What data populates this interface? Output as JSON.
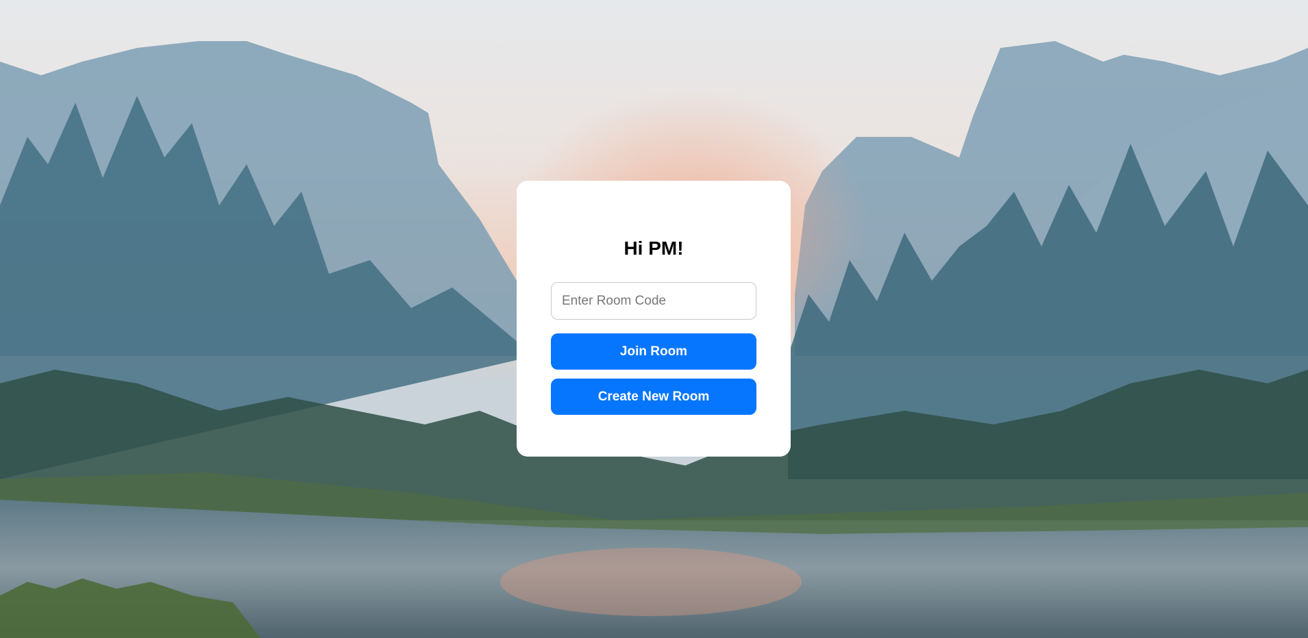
{
  "card": {
    "greeting": "Hi PM!",
    "room_code_placeholder": "Enter Room Code",
    "room_code_value": "",
    "join_label": "Join Room",
    "create_label": "Create New Room"
  },
  "colors": {
    "accent": "#0776ff",
    "card_background": "#ffffff"
  }
}
